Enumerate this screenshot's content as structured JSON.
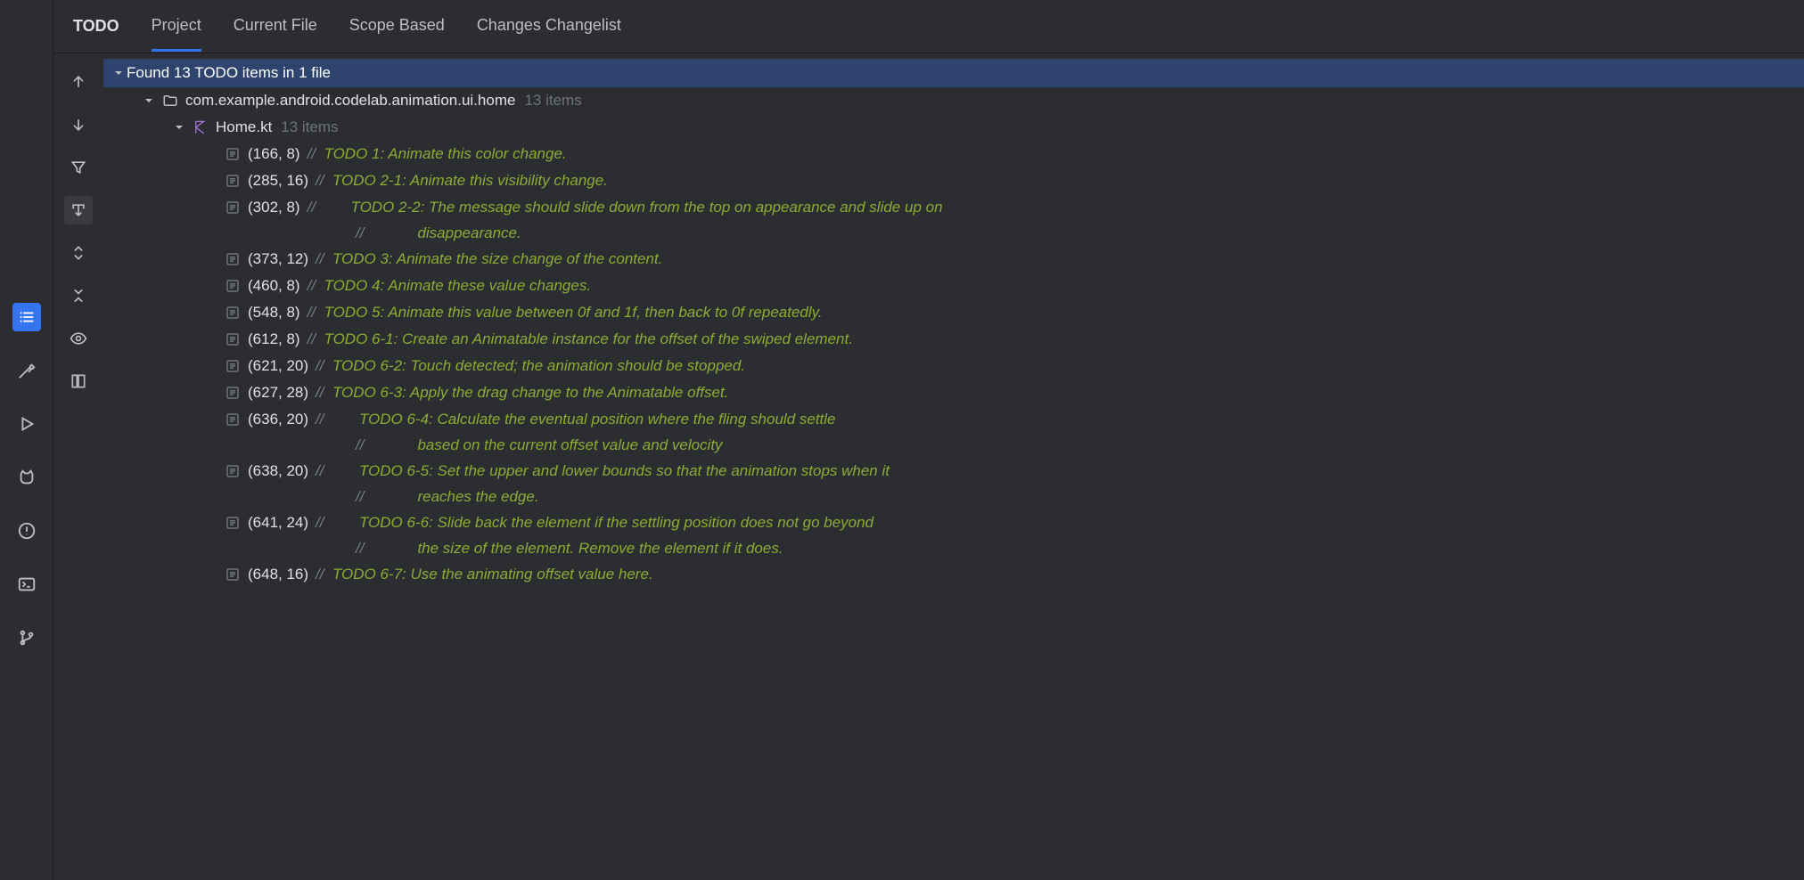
{
  "tabs": {
    "title": "TODO",
    "items": [
      "Project",
      "Current File",
      "Scope Based",
      "Changes Changelist"
    ],
    "active": 0
  },
  "summary": "Found 13 TODO items in 1 file",
  "package": {
    "name": "com.example.android.codelab.animation.ui.home",
    "count": "13 items"
  },
  "file": {
    "name": "Home.kt",
    "count": "13 items"
  },
  "todos": [
    {
      "loc": "(166, 8)",
      "slash": "//",
      "text": "TODO 1: Animate this color change."
    },
    {
      "loc": "(285, 16)",
      "slash": "//",
      "text": "TODO 2-1: Animate this visibility change."
    },
    {
      "loc": "(302, 8)",
      "slash": "//",
      "text": "TODO 2-2: The message should slide down from the top on appearance and slide up on",
      "cont": [
        {
          "slash": "//",
          "text": "disappearance."
        }
      ]
    },
    {
      "loc": "(373, 12)",
      "slash": "//",
      "text": "TODO 3: Animate the size change of the content."
    },
    {
      "loc": "(460, 8)",
      "slash": "//",
      "text": "TODO 4: Animate these value changes."
    },
    {
      "loc": "(548, 8)",
      "slash": "//",
      "text": "TODO 5: Animate this value between 0f and 1f, then back to 0f repeatedly."
    },
    {
      "loc": "(612, 8)",
      "slash": "//",
      "text": "TODO 6-1: Create an Animatable instance for the offset of the swiped element."
    },
    {
      "loc": "(621, 20)",
      "slash": "//",
      "text": "TODO 6-2: Touch detected; the animation should be stopped."
    },
    {
      "loc": "(627, 28)",
      "slash": "//",
      "text": "TODO 6-3: Apply the drag change to the Animatable offset."
    },
    {
      "loc": "(636, 20)",
      "slash": "//",
      "text": "TODO 6-4: Calculate the eventual position where the fling should settle",
      "cont": [
        {
          "slash": "//",
          "text": "based on the current offset value and velocity"
        }
      ]
    },
    {
      "loc": "(638, 20)",
      "slash": "//",
      "text": "TODO 6-5: Set the upper and lower bounds so that the animation stops when it",
      "cont": [
        {
          "slash": "//",
          "text": "reaches the edge."
        }
      ]
    },
    {
      "loc": "(641, 24)",
      "slash": "//",
      "text": "TODO 6-6: Slide back the element if the settling position does not go beyond",
      "cont": [
        {
          "slash": "//",
          "text": "the size of the element. Remove the element if it does."
        }
      ]
    },
    {
      "loc": "(648, 16)",
      "slash": "//",
      "text": "TODO 6-7: Use the animating offset value here."
    }
  ]
}
